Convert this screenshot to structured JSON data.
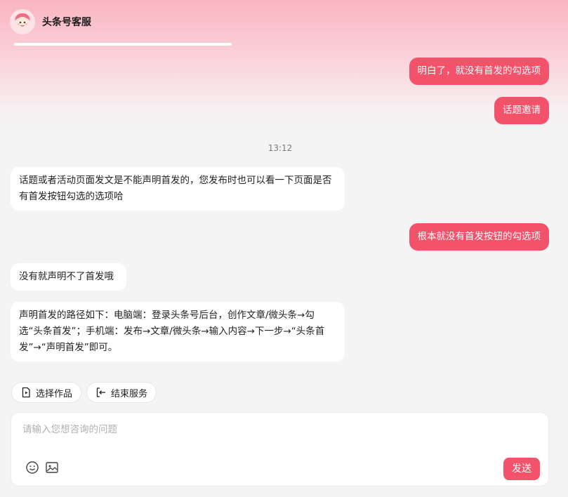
{
  "header": {
    "service_name": "头条号客服"
  },
  "messages": {
    "user_1": "明白了，就没有首发的勾选项",
    "user_2": "话题邀请",
    "timestamp": "13:12",
    "bot_1": "话题或者活动页面发文是不能声明首发的，您发布时也可以看一下页面是否有首发按钮勾选的选项哈",
    "user_3": "根本就没有首发按钮的勾选项",
    "bot_2": "没有就声明不了首发哦",
    "bot_3": "声明首发的路径如下：电脑端：登录头条号后台，创作文章/微头条→勾选“头条首发”；手机端：发布→文章/微头条→输入内容→下一步→“头条首发”→“声明首发”即可。"
  },
  "quick_actions": {
    "select_work": "选择作品",
    "end_service": "结束服务"
  },
  "input": {
    "placeholder": "请输入您想咨询的问题",
    "value": ""
  },
  "send_label": "发送",
  "icons": {
    "avatar": "avatar-icon",
    "select_work": "document-icon",
    "end_service": "exit-icon",
    "emoji": "emoji-icon",
    "image": "image-icon"
  },
  "colors": {
    "accent": "#f2536b",
    "background": "#f4f4f5",
    "header_gradient_top": "#f9b5c1"
  }
}
